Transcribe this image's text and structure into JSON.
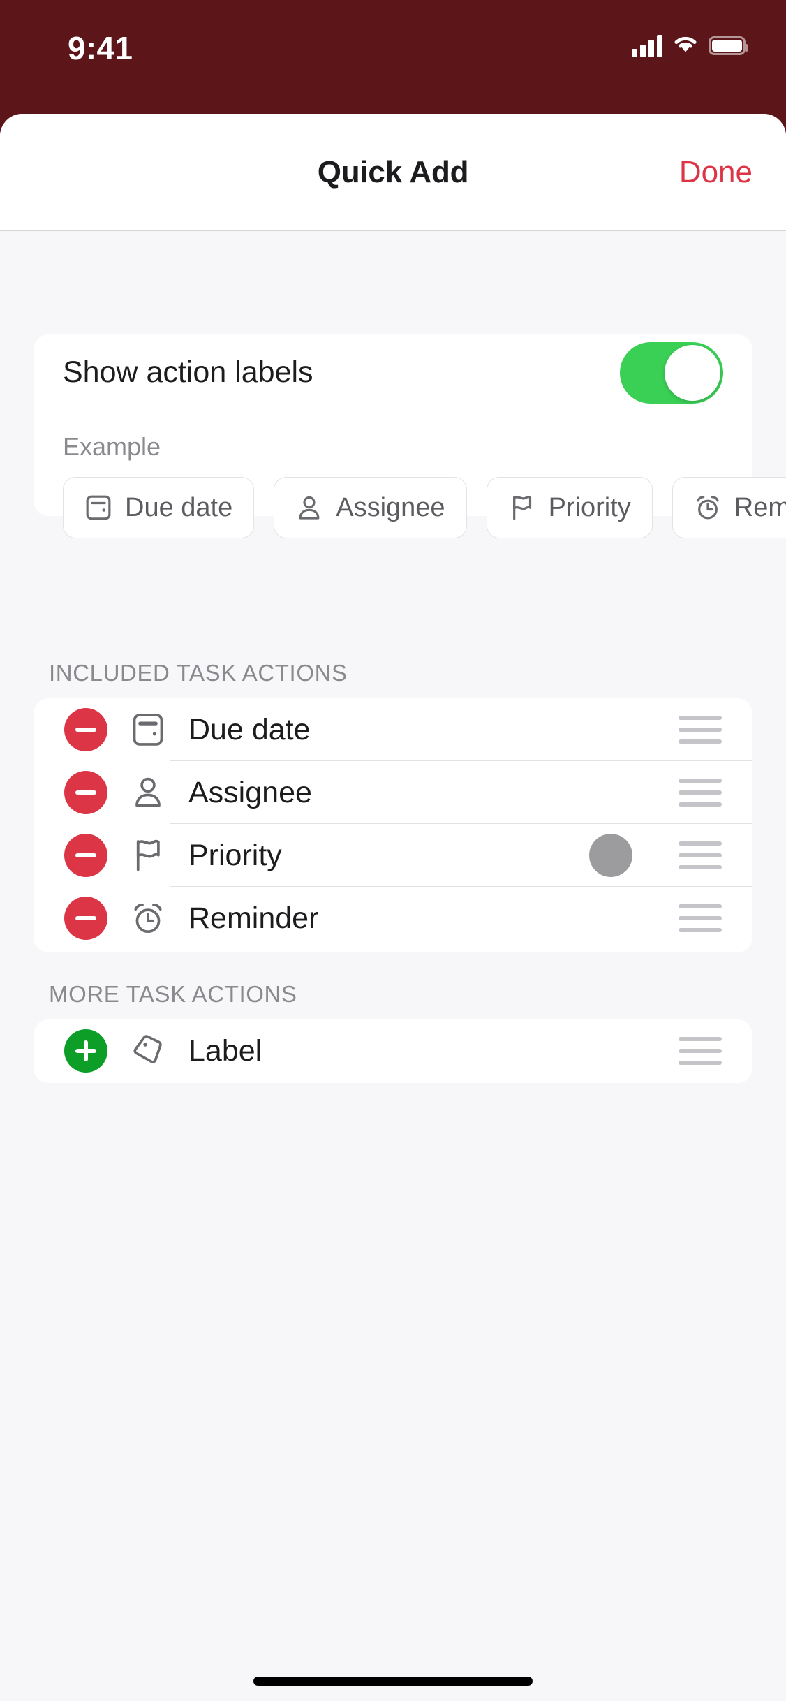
{
  "status_bar": {
    "time": "9:41",
    "background_color": "#5C1518",
    "icons": [
      "cellular-signal-icon",
      "wifi-icon",
      "battery-icon"
    ]
  },
  "nav_bar": {
    "title": "Quick Add",
    "done_label": "Done",
    "done_color": "#DC3545"
  },
  "toggle_card": {
    "label": "Show action labels",
    "enabled": true,
    "toggle_on_color": "#3ACF55",
    "example_label": "Example",
    "chips": [
      {
        "label": "Due date",
        "icon": "calendar-icon"
      },
      {
        "label": "Assignee",
        "icon": "person-icon"
      },
      {
        "label": "Priority",
        "icon": "flag-icon"
      },
      {
        "label": "Reminder",
        "icon": "alarm-clock-icon"
      }
    ]
  },
  "included_section": {
    "header": "INCLUDED TASK ACTIONS",
    "rows": [
      {
        "label": "Due date",
        "icon": "calendar-icon",
        "action": "remove",
        "accessory": "none"
      },
      {
        "label": "Assignee",
        "icon": "person-icon",
        "action": "remove",
        "accessory": "none"
      },
      {
        "label": "Priority",
        "icon": "flag-icon",
        "action": "remove",
        "accessory": "gray-circle"
      },
      {
        "label": "Reminder",
        "icon": "alarm-clock-icon",
        "action": "remove",
        "accessory": "none"
      }
    ],
    "remove_button_color": "#DC3545"
  },
  "more_section": {
    "header": "MORE TASK ACTIONS",
    "rows": [
      {
        "label": "Label",
        "icon": "tag-icon",
        "action": "add",
        "accessory": "none"
      }
    ],
    "add_button_color": "#0D9E28"
  }
}
